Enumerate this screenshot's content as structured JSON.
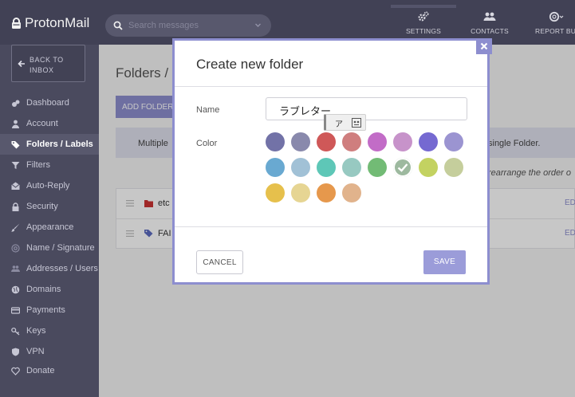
{
  "brand": {
    "name": "ProtonMail"
  },
  "search": {
    "placeholder": "Search messages"
  },
  "topnav": [
    {
      "label": "SETTINGS",
      "icon": "cogs-icon"
    },
    {
      "label": "CONTACTS",
      "icon": "contacts-icon"
    },
    {
      "label": "REPORT BUG",
      "icon": "bug-icon"
    }
  ],
  "sidebar": {
    "back_label_line1": "BACK TO",
    "back_label_line2": "INBOX",
    "items": [
      {
        "label": "Dashboard",
        "icon": "dashboard-icon"
      },
      {
        "label": "Account",
        "icon": "user-icon"
      },
      {
        "label": "Folders / Labels",
        "icon": "tags-icon",
        "active": true
      },
      {
        "label": "Filters",
        "icon": "filter-icon"
      },
      {
        "label": "Auto-Reply",
        "icon": "auto-reply-icon"
      },
      {
        "label": "Security",
        "icon": "lock-icon"
      },
      {
        "label": "Appearance",
        "icon": "paintbrush-icon"
      },
      {
        "label": "Name / Signature",
        "icon": "at-icon"
      },
      {
        "label": "Addresses / Users",
        "icon": "users-icon"
      },
      {
        "label": "Domains",
        "icon": "globe-icon"
      },
      {
        "label": "Payments",
        "icon": "credit-card-icon"
      },
      {
        "label": "Keys",
        "icon": "key-icon"
      },
      {
        "label": "VPN",
        "icon": "shield-icon"
      },
      {
        "label": "Donate",
        "icon": "heart-icon"
      }
    ]
  },
  "main": {
    "title": "Folders /",
    "add_folder_label": "ADD FOLDER",
    "info_left": "Multiple",
    "info_right": "single Folder.",
    "hint": "rearrange the order o",
    "rows": [
      {
        "name": "etc",
        "icon": "folder-icon",
        "icon_color": "#cc3333",
        "edit": "ED"
      },
      {
        "name": "FAI",
        "icon": "label-icon",
        "icon_color": "#5c6bc0",
        "edit": "ED"
      }
    ]
  },
  "modal": {
    "title": "Create new folder",
    "name_label": "Name",
    "name_value": "ラブレター",
    "ime_kana": "ア",
    "color_label": "Color",
    "colors": [
      "#7272a7",
      "#8989ac",
      "#cf5858",
      "#cf7e7e",
      "#c26cc7",
      "#c793ca",
      "#7569d1",
      "#9b94d1",
      "#69a9d1",
      "#a1c1d6",
      "#5ec7b7",
      "#97c9c1",
      "#72bb75",
      "#9db99f",
      "#c3d261",
      "#c5ce9c",
      "#e6c04c",
      "#e6d593",
      "#e6984c",
      "#e1b38c"
    ],
    "selected_color_index": 13,
    "cancel_label": "CANCEL",
    "save_label": "SAVE"
  }
}
